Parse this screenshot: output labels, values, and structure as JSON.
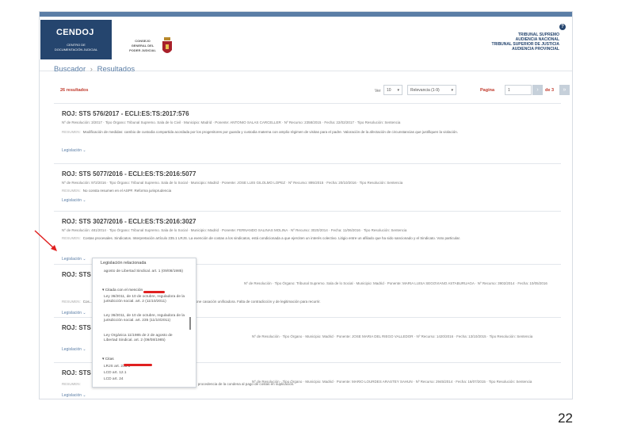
{
  "header": {
    "logo_title": "CENDOJ",
    "logo_sub1": "CENTRO DE",
    "logo_sub2": "DOCUMENTACIÓN JUDICIAL",
    "cgpj1": "CONSEJO",
    "cgpj2": "GENERAL DEL",
    "cgpj3": "PODER JUDICIAL",
    "help": "?",
    "courts": [
      "TRIBUNAL SUPREMO",
      "AUDIENCIA NACIONAL",
      "TRIBUNAL SUPERIOR DE JUSTICIA",
      "AUDIENCIA PROVINCIAL"
    ]
  },
  "breadcrumb": {
    "first": "Buscador",
    "sep": "›",
    "current": "Resultados"
  },
  "results_bar": {
    "count": "26 resultados",
    "view_label": "Ver",
    "per_page": "10",
    "sort": "Relevancia (1-9)",
    "page_label": "Pagina",
    "page_value": "1",
    "page_of": "de 3",
    "go": "›",
    "next": "»"
  },
  "results": [
    {
      "roj": "ROJ: STS 576/2017 - ECLI:ES:TS:2017:576",
      "meta": "Nº de Resolución: 3/2017 · Tipo Órgano: Tribunal Supremo. Sala de lo Civil · Municipio: Madrid · Ponente: ANTONIO SALAS CARCELLER · Nº Recurso: 2358/2015 · Fecha: 22/02/2017 · Tipo Resolución: Sentencia",
      "summary_label": "RESUMEN:",
      "summary": "Modificación de medidas: cambio de custodia compartida acordada por los progenitores por guarda y custodia materna con amplio régimen de visitas para el padre. Valoración de la afectación de circunstancias que justifiquen la violación.",
      "legis": "Legislación ⌄"
    },
    {
      "roj": "ROJ: STS 5077/2016 - ECLI:ES:TS:2016:5077",
      "meta": "Nº de Resolución: 972/2016 · Tipo Órgano: Tribunal Supremo. Sala de lo Social · Municipio: Madrid · Ponente: JOSE LUIS GILOLMO LOPEZ · Nº Recurso: 895/2015 · Fecha: 20/10/2016 · Tipo Resolución: Sentencia",
      "summary_label": "RESUMEN:",
      "summary": "No consta resumen en el ASPF. Reforma jurisprudencia",
      "legis": "Legislación ⌄"
    },
    {
      "roj": "ROJ: STS 3027/2016 - ECLI:ES:TS:2016:3027",
      "meta": "Nº de Resolución: 481/2014 · Tipo Órgano: Tribunal Supremo. Sala de lo Social · Municipio: Madrid · Ponente: FERNANDO SALINAS MOLINA · Nº Recurso: 3020/2014 · Fecha: 11/06/2016 · Tipo Resolución: Sentencia",
      "summary_label": "RESUMEN:",
      "summary": "Costas procesales. Sindicatos. Interpretación artículo 235.1 LRJS. La exención de costas a los sindicatos, está condicionada a que ejerciten un interés colectivo. Litigio entre un afiliado que ha sido sancionado y el Sindicato. Voto particular.",
      "legis": "Legislación ⌄"
    },
    {
      "roj": "ROJ: STS 2",
      "meta": "Nº de Resolución · Tipo Órgano: Tribunal Supremo. Sala de lo Social · Municipio: Madrid · Ponente: MARIA LUISA SEGOVIANO ASTABURUAGA · Nº Recurso: 3902/2014 · Fecha: 10/05/2016",
      "summary_label": "RESUMEN:",
      "summary": "Cos... única demandada y recurrente en suplicación. El SCRIMO interpone casación unificadora. Falta de contradicción y de legitimación para recurrir.",
      "legis": "Legislación ⌄"
    },
    {
      "roj": "ROJ: STS 4",
      "meta": "Nº de Resolución · Tipo Órgano · Municipio: Madrid · Ponente: JOSE MARIA DEL RIEGO VALLEDOR · Nº Recurso: 1420/2016 · Fecha: 13/10/2015 · Tipo Resolución: Sentencia",
      "summary_label": "RESUMEN:",
      "summary": "",
      "legis": "Legislación ⌄"
    },
    {
      "roj": "ROJ: STS 3",
      "meta": "Nº de Resolución · Tipo Órgano · Municipio: Madrid · Ponente: MARIO LOURDES ARASTEY SAHUN · Nº Recurso: 2945/2014 · Fecha: 16/07/2015 · Tipo Resolución: Sentencia",
      "summary_label": "RESUMEN:",
      "summary": "... procedencia de la condena al pago de costas en suplicación.",
      "legis": "Legislación ⌄"
    }
  ],
  "dropdown": {
    "title": "Legislación relacionada",
    "item0": "agosto de Libertad Sindical. art. 1 (09/08/1985)",
    "head1": "▾ Citada con el mención",
    "item1": "Ley 36/2011, de 10 de octubre, reguladora de la jurisdicción social. art. 2 (11/10/2011)",
    "item2": "Ley 36/2011, de 10 de octubre, reguladora de la jurisdicción social. art. 235 (11/10/2011)",
    "item3": "Ley Orgánica 11/1985 de 2 de agosto de Libertad Sindical. art. 2 (09/08/1985)",
    "head2": "▾ Citas",
    "item4": "LRJS art. 235.1",
    "item5": "LCD art. 12.1",
    "item6": "LCD art. 24"
  },
  "page_number": "22"
}
